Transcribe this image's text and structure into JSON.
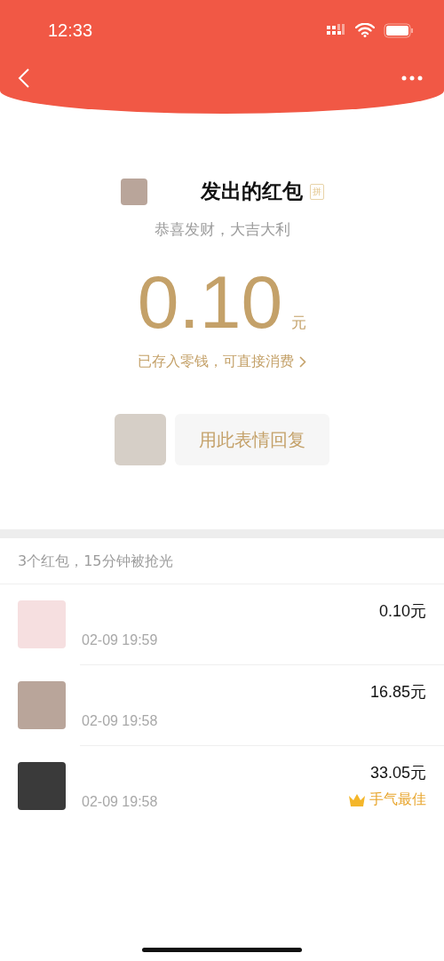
{
  "status_bar": {
    "time": "12:33"
  },
  "envelope": {
    "title": "发出的红包",
    "tag": "拼",
    "greeting": "恭喜发财，大吉大利",
    "amount": "0.10",
    "unit": "元",
    "note": "已存入零钱，可直接消费",
    "reply_button": "用此表情回复"
  },
  "summary": "3个红包，15分钟被抢光",
  "recipients": [
    {
      "time": "02-09 19:59",
      "amount": "0.10元",
      "best": false
    },
    {
      "time": "02-09 19:58",
      "amount": "16.85元",
      "best": false
    },
    {
      "time": "02-09 19:58",
      "amount": "33.05元",
      "best": true,
      "best_label": "手气最佳"
    }
  ]
}
